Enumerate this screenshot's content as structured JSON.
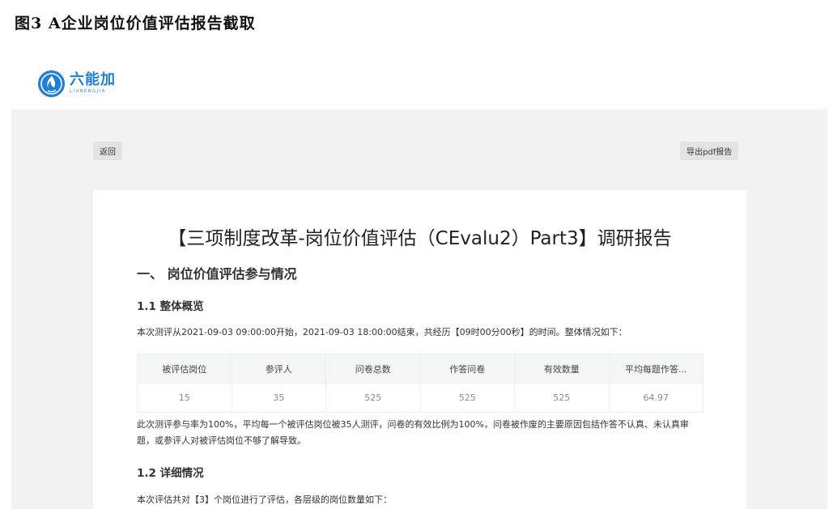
{
  "figure_caption": "图3 A企业岗位价值评估报告截取",
  "logo": {
    "name": "六能加",
    "subtitle": "LIUNENGJIA"
  },
  "toolbar": {
    "back_label": "返回",
    "export_label": "导出pdf报告"
  },
  "report": {
    "title": "【三项制度改革-岗位价值评估（CEvalu2）Part3】调研报告",
    "section1_title": "一、 岗位价值评估参与情况",
    "overview_title": "1.1 整体概览",
    "overview_text": "本次测评从2021-09-03 09:00:00开始，2021-09-03 18:00:00结束，共经历【09时00分00秒】的时间。整体情况如下：",
    "table": {
      "headers": [
        "被评估岗位",
        "参评人",
        "问卷总数",
        "作答问卷",
        "有效数量",
        "平均每题作答..."
      ],
      "rows": [
        [
          "15",
          "35",
          "525",
          "525",
          "525",
          "64.97"
        ]
      ]
    },
    "summary_text": "此次测评参与率为100%，平均每一个被评估岗位被35人测评，问卷的有效比例为100%，问卷被作废的主要原因包括作答不认真、未认真审题，或参评人对被评估岗位不够了解导致。",
    "detail_title": "1.2 详细情况",
    "detail_text": "本次评估共对【3】个岗位进行了评估，各层级的岗位数量如下："
  },
  "colors": {
    "brand": "#1f7fd6",
    "background": "#f2f2f3",
    "card": "#ffffff"
  }
}
